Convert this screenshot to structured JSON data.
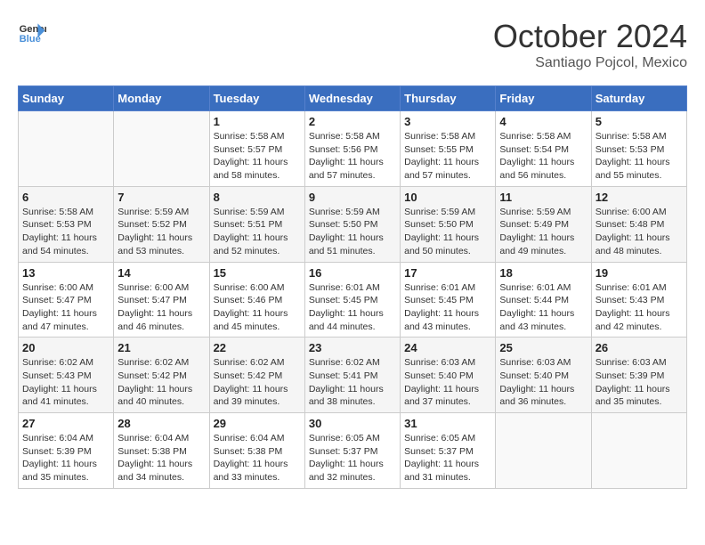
{
  "header": {
    "logo_line1": "General",
    "logo_line2": "Blue",
    "month": "October 2024",
    "location": "Santiago Pojcol, Mexico"
  },
  "days_of_week": [
    "Sunday",
    "Monday",
    "Tuesday",
    "Wednesday",
    "Thursday",
    "Friday",
    "Saturday"
  ],
  "weeks": [
    [
      {
        "day": "",
        "info": ""
      },
      {
        "day": "",
        "info": ""
      },
      {
        "day": "1",
        "info": "Sunrise: 5:58 AM\nSunset: 5:57 PM\nDaylight: 11 hours and 58 minutes."
      },
      {
        "day": "2",
        "info": "Sunrise: 5:58 AM\nSunset: 5:56 PM\nDaylight: 11 hours and 57 minutes."
      },
      {
        "day": "3",
        "info": "Sunrise: 5:58 AM\nSunset: 5:55 PM\nDaylight: 11 hours and 57 minutes."
      },
      {
        "day": "4",
        "info": "Sunrise: 5:58 AM\nSunset: 5:54 PM\nDaylight: 11 hours and 56 minutes."
      },
      {
        "day": "5",
        "info": "Sunrise: 5:58 AM\nSunset: 5:53 PM\nDaylight: 11 hours and 55 minutes."
      }
    ],
    [
      {
        "day": "6",
        "info": "Sunrise: 5:58 AM\nSunset: 5:53 PM\nDaylight: 11 hours and 54 minutes."
      },
      {
        "day": "7",
        "info": "Sunrise: 5:59 AM\nSunset: 5:52 PM\nDaylight: 11 hours and 53 minutes."
      },
      {
        "day": "8",
        "info": "Sunrise: 5:59 AM\nSunset: 5:51 PM\nDaylight: 11 hours and 52 minutes."
      },
      {
        "day": "9",
        "info": "Sunrise: 5:59 AM\nSunset: 5:50 PM\nDaylight: 11 hours and 51 minutes."
      },
      {
        "day": "10",
        "info": "Sunrise: 5:59 AM\nSunset: 5:50 PM\nDaylight: 11 hours and 50 minutes."
      },
      {
        "day": "11",
        "info": "Sunrise: 5:59 AM\nSunset: 5:49 PM\nDaylight: 11 hours and 49 minutes."
      },
      {
        "day": "12",
        "info": "Sunrise: 6:00 AM\nSunset: 5:48 PM\nDaylight: 11 hours and 48 minutes."
      }
    ],
    [
      {
        "day": "13",
        "info": "Sunrise: 6:00 AM\nSunset: 5:47 PM\nDaylight: 11 hours and 47 minutes."
      },
      {
        "day": "14",
        "info": "Sunrise: 6:00 AM\nSunset: 5:47 PM\nDaylight: 11 hours and 46 minutes."
      },
      {
        "day": "15",
        "info": "Sunrise: 6:00 AM\nSunset: 5:46 PM\nDaylight: 11 hours and 45 minutes."
      },
      {
        "day": "16",
        "info": "Sunrise: 6:01 AM\nSunset: 5:45 PM\nDaylight: 11 hours and 44 minutes."
      },
      {
        "day": "17",
        "info": "Sunrise: 6:01 AM\nSunset: 5:45 PM\nDaylight: 11 hours and 43 minutes."
      },
      {
        "day": "18",
        "info": "Sunrise: 6:01 AM\nSunset: 5:44 PM\nDaylight: 11 hours and 43 minutes."
      },
      {
        "day": "19",
        "info": "Sunrise: 6:01 AM\nSunset: 5:43 PM\nDaylight: 11 hours and 42 minutes."
      }
    ],
    [
      {
        "day": "20",
        "info": "Sunrise: 6:02 AM\nSunset: 5:43 PM\nDaylight: 11 hours and 41 minutes."
      },
      {
        "day": "21",
        "info": "Sunrise: 6:02 AM\nSunset: 5:42 PM\nDaylight: 11 hours and 40 minutes."
      },
      {
        "day": "22",
        "info": "Sunrise: 6:02 AM\nSunset: 5:42 PM\nDaylight: 11 hours and 39 minutes."
      },
      {
        "day": "23",
        "info": "Sunrise: 6:02 AM\nSunset: 5:41 PM\nDaylight: 11 hours and 38 minutes."
      },
      {
        "day": "24",
        "info": "Sunrise: 6:03 AM\nSunset: 5:40 PM\nDaylight: 11 hours and 37 minutes."
      },
      {
        "day": "25",
        "info": "Sunrise: 6:03 AM\nSunset: 5:40 PM\nDaylight: 11 hours and 36 minutes."
      },
      {
        "day": "26",
        "info": "Sunrise: 6:03 AM\nSunset: 5:39 PM\nDaylight: 11 hours and 35 minutes."
      }
    ],
    [
      {
        "day": "27",
        "info": "Sunrise: 6:04 AM\nSunset: 5:39 PM\nDaylight: 11 hours and 35 minutes."
      },
      {
        "day": "28",
        "info": "Sunrise: 6:04 AM\nSunset: 5:38 PM\nDaylight: 11 hours and 34 minutes."
      },
      {
        "day": "29",
        "info": "Sunrise: 6:04 AM\nSunset: 5:38 PM\nDaylight: 11 hours and 33 minutes."
      },
      {
        "day": "30",
        "info": "Sunrise: 6:05 AM\nSunset: 5:37 PM\nDaylight: 11 hours and 32 minutes."
      },
      {
        "day": "31",
        "info": "Sunrise: 6:05 AM\nSunset: 5:37 PM\nDaylight: 11 hours and 31 minutes."
      },
      {
        "day": "",
        "info": ""
      },
      {
        "day": "",
        "info": ""
      }
    ]
  ]
}
